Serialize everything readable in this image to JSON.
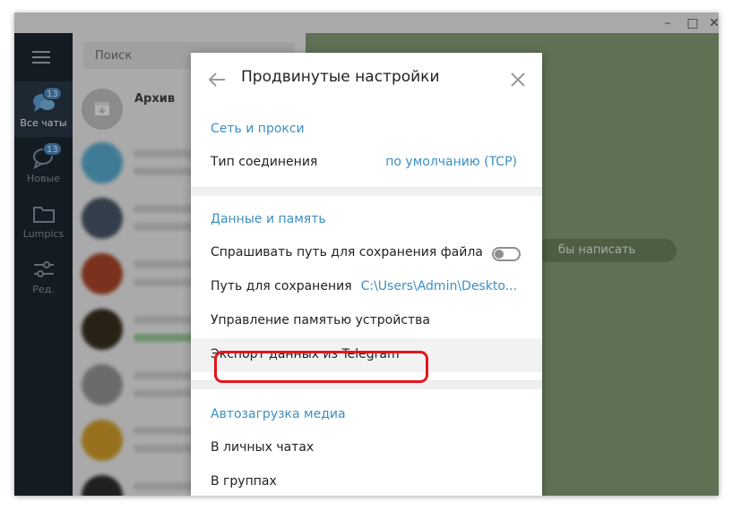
{
  "window": {
    "controls": {
      "minimize": "–",
      "maximize": "□",
      "close": "✕"
    }
  },
  "sidebar": {
    "folders": [
      {
        "label": "Все чаты",
        "badge": "13",
        "icon": "chats-icon",
        "active": true
      },
      {
        "label": "Новые",
        "badge": "13",
        "icon": "chat-bubble-icon",
        "active": false
      },
      {
        "label": "Lumpics",
        "badge": "",
        "icon": "folder-icon",
        "active": false
      },
      {
        "label": "Ред.",
        "badge": "",
        "icon": "sliders-icon",
        "active": false
      }
    ]
  },
  "chatlist": {
    "search_placeholder": "Поиск",
    "archive_label": "Архив"
  },
  "chat": {
    "placeholder_tail": "бы написать"
  },
  "dialog": {
    "title": "Продвинутые настройки",
    "network": {
      "title": "Сеть и прокси",
      "connection_type_label": "Тип соединения",
      "connection_type_value": "по умолчанию (TCP)"
    },
    "data": {
      "title": "Данные и память",
      "ask_path_label": "Спрашивать путь для сохранения файла",
      "ask_path_enabled": false,
      "save_path_label": "Путь для сохранения",
      "save_path_value": "C:\\Users\\Admin\\Deskto...",
      "memory_label": "Управление памятью устройства",
      "export_label": "Экспорт данных из Telegram"
    },
    "media": {
      "title": "Автозагрузка медиа",
      "private_chats_label": "В личных чатах",
      "groups_label": "В группах"
    }
  },
  "colors": {
    "accent": "#3a8fc4",
    "sidebar_bg": "#1c2733",
    "badge": "#4e8fc7",
    "highlight": "#e3161c"
  }
}
